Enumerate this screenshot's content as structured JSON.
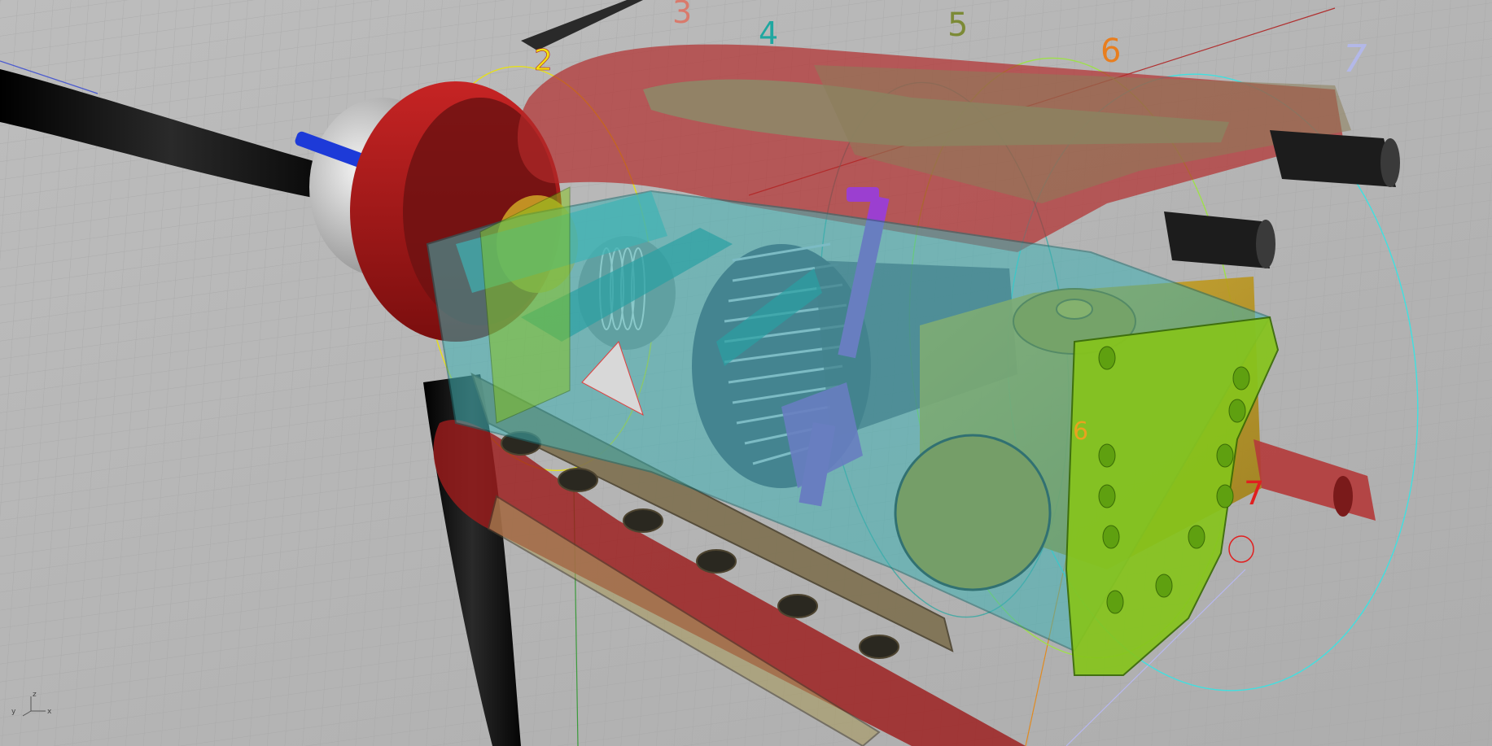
{
  "viewport": {
    "background_color": "#b4b4b4",
    "grid_color": "#a4a4a4"
  },
  "section_labels": [
    {
      "text": "2",
      "color": "#f2e10f"
    },
    {
      "text": "3",
      "color": "#d97a6c"
    },
    {
      "text": "4",
      "color": "#1fa7a0"
    },
    {
      "text": "5",
      "color": "#7c8a36"
    },
    {
      "text": "6",
      "color": "#e87e1f"
    },
    {
      "text": "7",
      "color": "#b3b8e8"
    },
    {
      "text": "7",
      "color": "#e02020"
    },
    {
      "text": "6",
      "color": "#e8a21f"
    }
  ],
  "axis_widget": {
    "x_label": "x",
    "y_label": "y",
    "z_label": "z"
  },
  "model_colors": {
    "propeller": "#111111",
    "spinner": "#d8d8d8",
    "cowl_red": "#b01818",
    "frame_cyan": "#3fb2b4",
    "frame_green": "#8bd020",
    "fuel_tank": "#c8a01a",
    "exhaust_tan": "#8a7a4e",
    "cylinder": "#6a6a8a",
    "pushrod_purple": "#9b3fd0"
  }
}
